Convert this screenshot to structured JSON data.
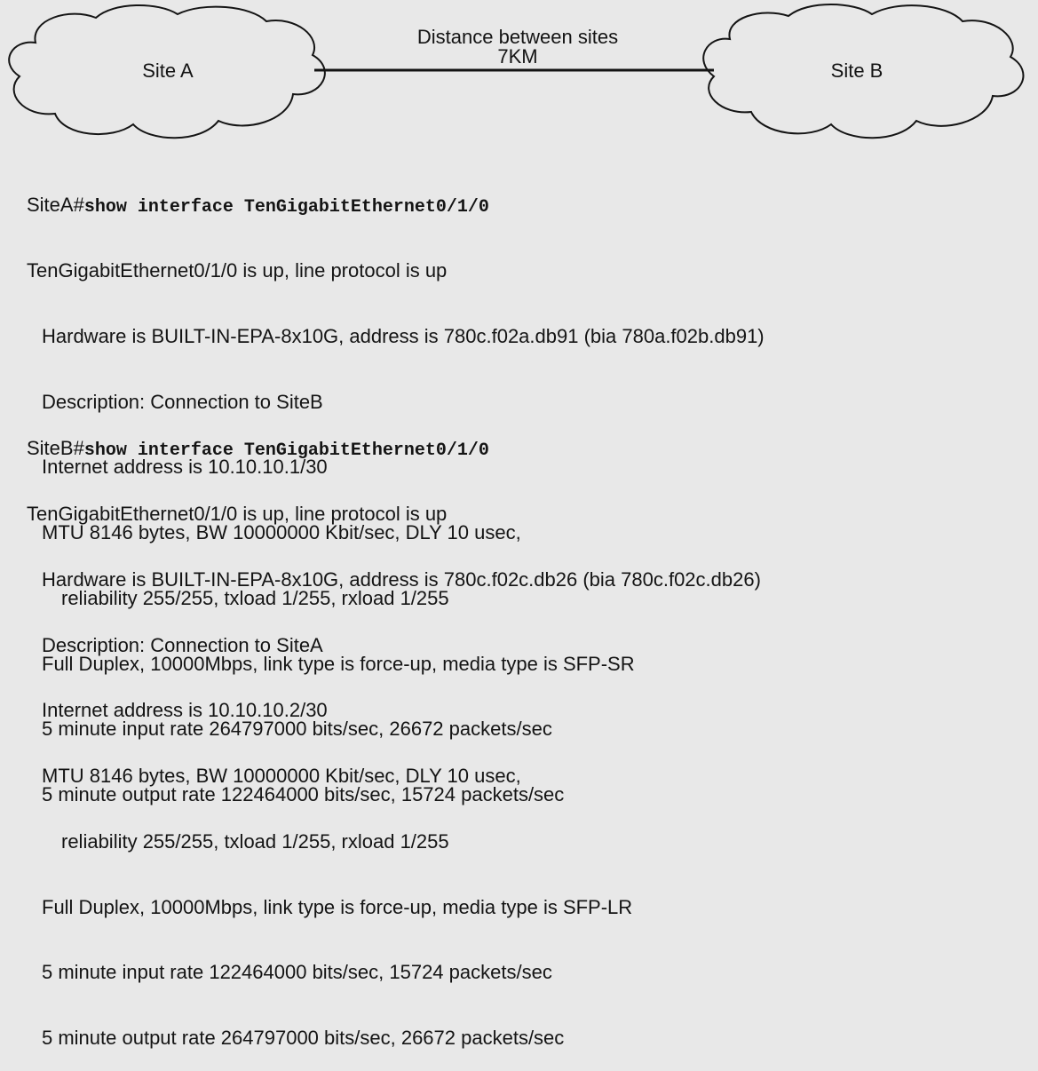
{
  "diagram": {
    "site_a": "Site A",
    "site_b": "Site B",
    "link_label_line1": "Distance between sites",
    "link_label_line2": "7KM"
  },
  "site_a_output": {
    "prompt": "SiteA#",
    "command": "show interface TenGigabitEthernet0/1/0",
    "lines": [
      "TenGigabitEthernet0/1/0 is up, line protocol is up",
      "Hardware is BUILT-IN-EPA-8x10G, address is 780c.f02a.db91 (bia 780a.f02b.db91)",
      "Description: Connection to SiteB",
      "Internet address is 10.10.10.1/30",
      "MTU 8146 bytes, BW 10000000 Kbit/sec, DLY 10 usec,",
      "reliability 255/255, txload 1/255, rxload 1/255",
      "Full Duplex, 10000Mbps, link type is force-up, media type is SFP-SR",
      "5 minute input rate 264797000 bits/sec, 26672 packets/sec",
      "5 minute output rate 122464000 bits/sec, 15724 packets/sec"
    ]
  },
  "site_b_output": {
    "prompt": "SiteB#",
    "command": "show interface TenGigabitEthernet0/1/0",
    "lines": [
      "TenGigabitEthernet0/1/0 is up, line protocol is up",
      "Hardware is BUILT-IN-EPA-8x10G, address is 780c.f02c.db26 (bia 780c.f02c.db26)",
      "Description: Connection to SiteA",
      "Internet address is 10.10.10.2/30",
      "MTU 8146 bytes, BW 10000000 Kbit/sec, DLY 10 usec,",
      "reliability 255/255, txload 1/255, rxload 1/255",
      "Full Duplex, 10000Mbps, link type is force-up, media type is SFP-LR",
      "5 minute input rate 122464000 bits/sec, 15724 packets/sec",
      "5 minute output rate 264797000 bits/sec, 26672 packets/sec"
    ]
  }
}
